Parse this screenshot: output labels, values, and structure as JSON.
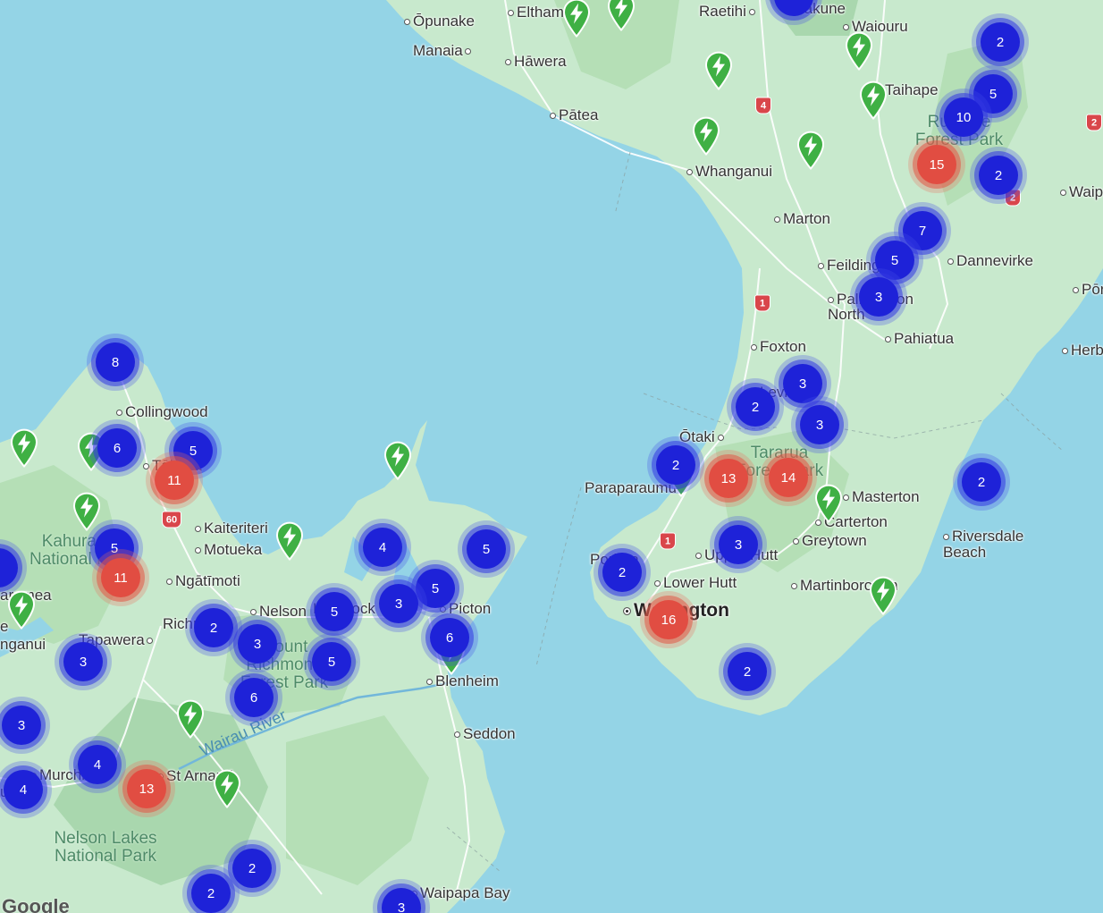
{
  "map": {
    "attribution": "Google",
    "places": [
      {
        "name": "Ōpunake"
      },
      {
        "name": "Eltham"
      },
      {
        "name": "Raetihi"
      },
      {
        "name": "Ohakune"
      },
      {
        "name": "Waiouru"
      },
      {
        "name": "Manaia"
      },
      {
        "name": "Hāwera"
      },
      {
        "name": "Taihape"
      },
      {
        "name": "Pātea"
      },
      {
        "name": "Whanganui"
      },
      {
        "name": "Marton"
      },
      {
        "name": "Feilding"
      },
      {
        "name": "Dannevirke"
      },
      {
        "name": "Palmerston North"
      },
      {
        "name": "Pahiatua"
      },
      {
        "name": "Foxton"
      },
      {
        "name": "Levin"
      },
      {
        "name": "Ōtaki"
      },
      {
        "name": "Paraparaumu"
      },
      {
        "name": "Masterton"
      },
      {
        "name": "Carterton"
      },
      {
        "name": "Greytown"
      },
      {
        "name": "Riversdale Beach"
      },
      {
        "name": "Porirua"
      },
      {
        "name": "Upper Hutt"
      },
      {
        "name": "Lower Hutt"
      },
      {
        "name": "Martinborough"
      },
      {
        "name": "Wellington"
      },
      {
        "name": "Collingwood"
      },
      {
        "name": "Tākaka"
      },
      {
        "name": "Kaiteriteri"
      },
      {
        "name": "Motueka"
      },
      {
        "name": "Ngātīmoti"
      },
      {
        "name": "Nelson"
      },
      {
        "name": "Havelock"
      },
      {
        "name": "Picton"
      },
      {
        "name": "Richmond"
      },
      {
        "name": "Tapawera"
      },
      {
        "name": "Blenheim"
      },
      {
        "name": "Seddon"
      },
      {
        "name": "Murchison"
      },
      {
        "name": "St Arnaud"
      },
      {
        "name": "Waipapa Bay"
      },
      {
        "name": "Waip"
      },
      {
        "name": "Pōr"
      },
      {
        "name": "Herb"
      },
      {
        "name": "aramea"
      },
      {
        "name": "nganui"
      },
      {
        "name": "ua"
      },
      {
        "name": "e"
      }
    ],
    "parks": [
      {
        "name": "Ruahine Forest Park"
      },
      {
        "name": "Tararua Forest Park"
      },
      {
        "name": "Kahurangi National Park"
      },
      {
        "name": "Mount Richmond Forest Park"
      },
      {
        "name": "Nelson Lakes National Park"
      }
    ],
    "rivers": [
      {
        "name": "Wairau River"
      }
    ],
    "highway_shields": [
      "4",
      "1",
      "1",
      "60",
      "2",
      "2"
    ],
    "clusters": [
      {
        "count": "2",
        "color": "blue"
      },
      {
        "count": "5",
        "color": "blue"
      },
      {
        "count": "10",
        "color": "blue"
      },
      {
        "count": "15",
        "color": "red"
      },
      {
        "count": "2",
        "color": "blue"
      },
      {
        "count": "7",
        "color": "blue"
      },
      {
        "count": "5",
        "color": "blue"
      },
      {
        "count": "3",
        "color": "blue"
      },
      {
        "count": "3",
        "color": "blue"
      },
      {
        "count": "2",
        "color": "blue"
      },
      {
        "count": "3",
        "color": "blue"
      },
      {
        "count": "2",
        "color": "blue"
      },
      {
        "count": "13",
        "color": "red"
      },
      {
        "count": "14",
        "color": "red"
      },
      {
        "count": "3",
        "color": "blue"
      },
      {
        "count": "2",
        "color": "blue"
      },
      {
        "count": "16",
        "color": "red"
      },
      {
        "count": "2",
        "color": "blue"
      },
      {
        "count": "2",
        "color": "blue"
      },
      {
        "count": "8",
        "color": "blue"
      },
      {
        "count": "6",
        "color": "blue"
      },
      {
        "count": "5",
        "color": "blue"
      },
      {
        "count": "11",
        "color": "red"
      },
      {
        "count": "5",
        "color": "blue"
      },
      {
        "count": "11",
        "color": "red"
      },
      {
        "count": "4",
        "color": "blue"
      },
      {
        "count": "5",
        "color": "blue"
      },
      {
        "count": "5",
        "color": "blue"
      },
      {
        "count": "3",
        "color": "blue"
      },
      {
        "count": "5",
        "color": "blue"
      },
      {
        "count": "6",
        "color": "blue"
      },
      {
        "count": "2",
        "color": "blue"
      },
      {
        "count": "3",
        "color": "blue"
      },
      {
        "count": "5",
        "color": "blue"
      },
      {
        "count": "6",
        "color": "blue"
      },
      {
        "count": "3",
        "color": "blue"
      },
      {
        "count": "3",
        "color": "blue"
      },
      {
        "count": "4",
        "color": "blue"
      },
      {
        "count": "4",
        "color": "blue"
      },
      {
        "count": "13",
        "color": "red"
      },
      {
        "count": "2",
        "color": "blue"
      },
      {
        "count": "2",
        "color": "blue"
      },
      {
        "count": "3",
        "color": "blue"
      }
    ],
    "charger_icon": "ev-charging-station-icon",
    "colors": {
      "water": "#94d4e6",
      "land": "#c6e8cb",
      "cluster_blue": "#1e22d8",
      "cluster_red": "#e14d42",
      "charger": "#3fb044"
    }
  }
}
